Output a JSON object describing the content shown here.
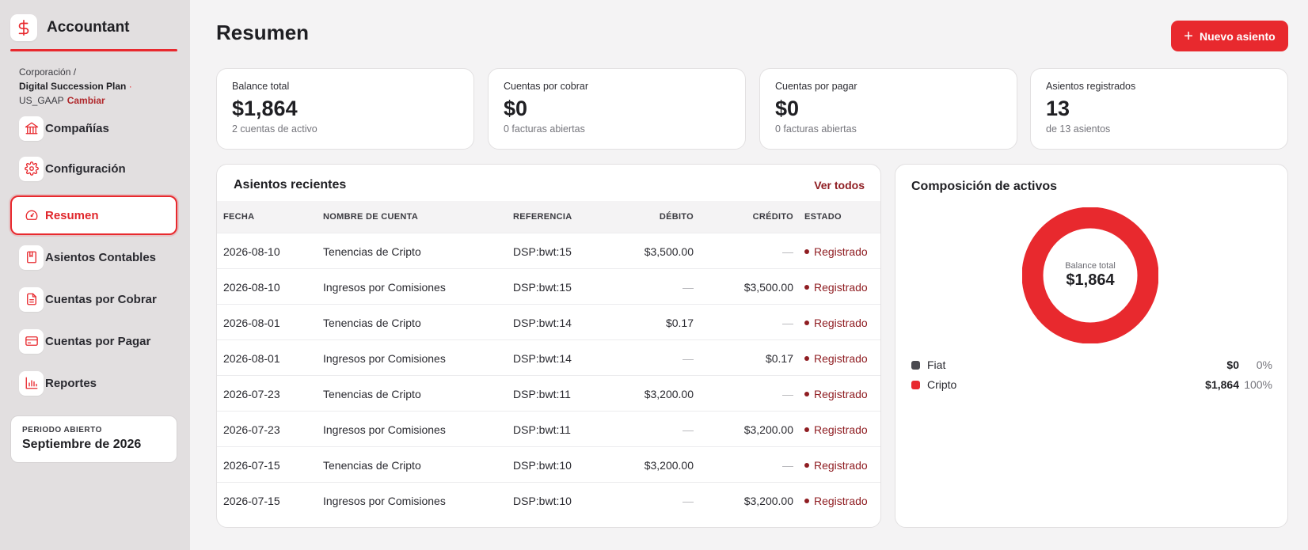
{
  "app": {
    "name": "Accountant"
  },
  "context": {
    "org": "Corporación",
    "separator": "/",
    "plan": "Digital Succession Plan",
    "dot": "·",
    "standard": "US_GAAP",
    "change_label": "Cambiar"
  },
  "sidebar": {
    "items": [
      {
        "label": "Compañías",
        "icon": "bank-icon"
      },
      {
        "label": "Configuración",
        "icon": "gear-icon"
      },
      {
        "label": "Resumen",
        "icon": "gauge-icon",
        "active": true
      },
      {
        "label": "Asientos Contables",
        "icon": "book-icon"
      },
      {
        "label": "Cuentas por Cobrar",
        "icon": "document-icon"
      },
      {
        "label": "Cuentas por Pagar",
        "icon": "credit-card-icon"
      },
      {
        "label": "Reportes",
        "icon": "bar-chart-icon"
      }
    ],
    "period": {
      "label": "PERIODO ABIERTO",
      "value": "Septiembre de 2026"
    }
  },
  "header": {
    "title": "Resumen",
    "new_button": "Nuevo asiento"
  },
  "stats": [
    {
      "label": "Balance total",
      "value": "$1,864",
      "sub": "2 cuentas de activo"
    },
    {
      "label": "Cuentas por cobrar",
      "value": "$0",
      "sub": "0 facturas abiertas"
    },
    {
      "label": "Cuentas por pagar",
      "value": "$0",
      "sub": "0 facturas abiertas"
    },
    {
      "label": "Asientos registrados",
      "value": "13",
      "sub": "de 13 asientos"
    }
  ],
  "entries": {
    "title": "Asientos recientes",
    "view_all": "Ver todos",
    "columns": [
      "FECHA",
      "NOMBRE DE CUENTA",
      "REFERENCIA",
      "DÉBITO",
      "CRÉDITO",
      "ESTADO"
    ],
    "rows": [
      {
        "date": "2026-08-10",
        "account": "Tenencias de Cripto",
        "ref": "DSP:bwt:15",
        "debit": "$3,500.00",
        "credit": "—",
        "status": "Registrado"
      },
      {
        "date": "2026-08-10",
        "account": "Ingresos por Comisiones",
        "ref": "DSP:bwt:15",
        "debit": "—",
        "credit": "$3,500.00",
        "status": "Registrado"
      },
      {
        "date": "2026-08-01",
        "account": "Tenencias de Cripto",
        "ref": "DSP:bwt:14",
        "debit": "$0.17",
        "credit": "—",
        "status": "Registrado"
      },
      {
        "date": "2026-08-01",
        "account": "Ingresos por Comisiones",
        "ref": "DSP:bwt:14",
        "debit": "—",
        "credit": "$0.17",
        "status": "Registrado"
      },
      {
        "date": "2026-07-23",
        "account": "Tenencias de Cripto",
        "ref": "DSP:bwt:11",
        "debit": "$3,200.00",
        "credit": "—",
        "status": "Registrado"
      },
      {
        "date": "2026-07-23",
        "account": "Ingresos por Comisiones",
        "ref": "DSP:bwt:11",
        "debit": "—",
        "credit": "$3,200.00",
        "status": "Registrado"
      },
      {
        "date": "2026-07-15",
        "account": "Tenencias de Cripto",
        "ref": "DSP:bwt:10",
        "debit": "$3,200.00",
        "credit": "—",
        "status": "Registrado"
      },
      {
        "date": "2026-07-15",
        "account": "Ingresos por Comisiones",
        "ref": "DSP:bwt:10",
        "debit": "—",
        "credit": "$3,200.00",
        "status": "Registrado"
      }
    ]
  },
  "composition": {
    "title": "Composición de activos",
    "center_label": "Balance total",
    "center_value": "$1,864",
    "legend": [
      {
        "name": "Fiat",
        "amount": "$0",
        "pct": "0%",
        "color": "#4a4a50",
        "share": 0
      },
      {
        "name": "Cripto",
        "amount": "$1,864",
        "pct": "100%",
        "color": "#e8292e",
        "share": 1
      }
    ]
  },
  "colors": {
    "accent": "#e8292e",
    "accent_dark": "#8f1d22",
    "sidebar_bg": "#e2dfe0",
    "page_bg": "#f4f3f4"
  }
}
